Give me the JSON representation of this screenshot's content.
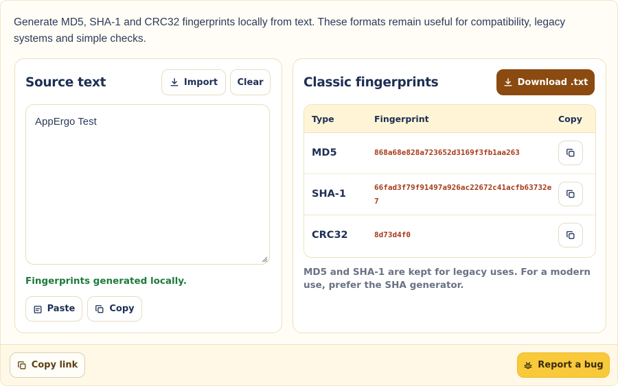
{
  "intro": "Generate MD5, SHA-1 and CRC32 fingerprints locally from text. These formats remain useful for compatibility, legacy systems and simple checks.",
  "source": {
    "title": "Source text",
    "import_label": "Import",
    "clear_label": "Clear",
    "text": "AppErgo Test",
    "status": "Fingerprints generated locally.",
    "paste_label": "Paste",
    "copy_label": "Copy"
  },
  "fingerprints": {
    "title": "Classic fingerprints",
    "download_label": "Download .txt",
    "headers": {
      "type": "Type",
      "fingerprint": "Fingerprint",
      "copy": "Copy"
    },
    "rows": [
      {
        "type": "MD5",
        "value": "868a68e828a723652d3169f3fb1aa263"
      },
      {
        "type": "SHA-1",
        "value": "66fad3f79f91497a926ac22672c41acfb63732e7"
      },
      {
        "type": "CRC32",
        "value": "8d73d4f0"
      }
    ],
    "note": "MD5 and SHA-1 are kept for legacy uses. For a modern use, prefer the SHA generator."
  },
  "footer": {
    "copy_link_label": "Copy link",
    "report_label": "Report a bug"
  },
  "colors": {
    "download_bg": "#8b4a10",
    "report_bg": "#f8c93a",
    "status_green": "#1d7a3a",
    "fingerprint_red": "#a53a18"
  }
}
